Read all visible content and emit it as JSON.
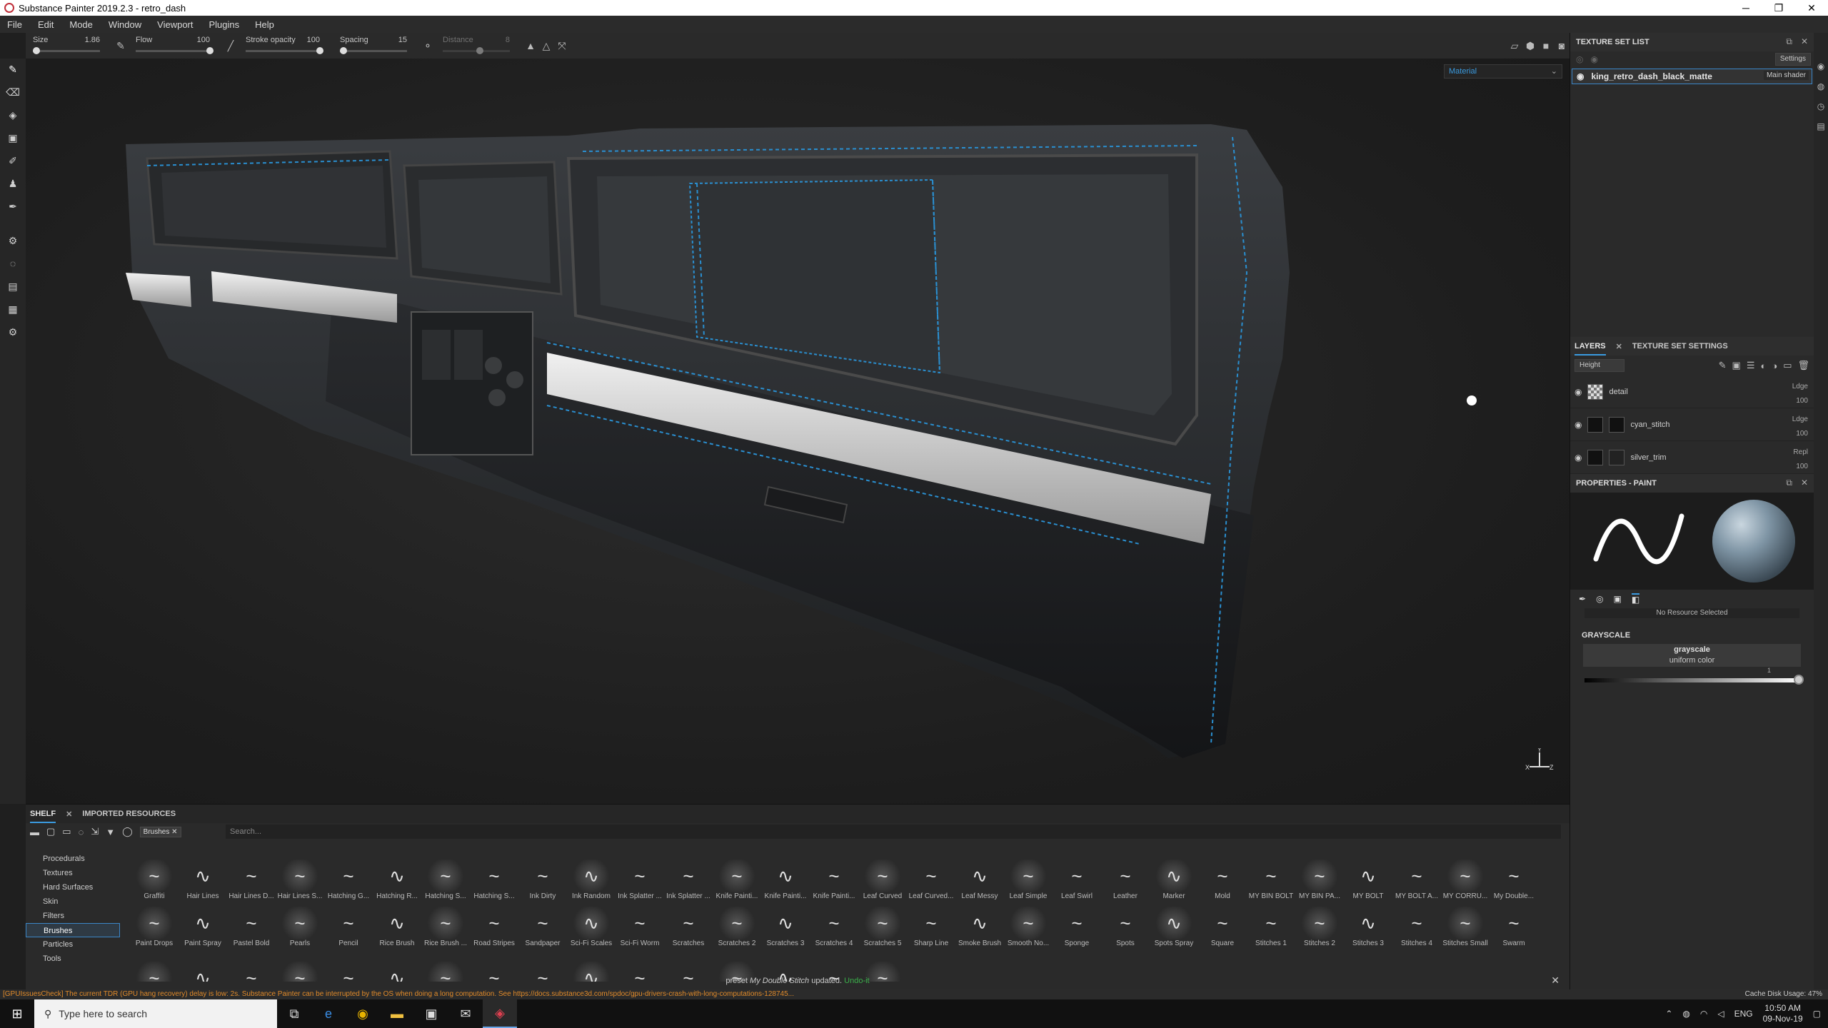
{
  "app": {
    "title": "Substance Painter 2019.2.3 - retro_dash"
  },
  "window_controls": {
    "minimize": "─",
    "maximize": "❐",
    "close": "✕"
  },
  "menu": [
    "File",
    "Edit",
    "Mode",
    "Window",
    "Viewport",
    "Plugins",
    "Help"
  ],
  "toolbar": {
    "size": {
      "label": "Size",
      "value": "1.86",
      "level": 0.05
    },
    "flow": {
      "label": "Flow",
      "value": "100",
      "level": 1.0
    },
    "stroke_opacity": {
      "label": "Stroke opacity",
      "value": "100",
      "level": 1.0
    },
    "spacing": {
      "label": "Spacing",
      "value": "15",
      "level": 0.05
    },
    "distance": {
      "label": "Distance",
      "value": "8"
    }
  },
  "viewport": {
    "material_mode": "Material",
    "axes": "Y\nX Z"
  },
  "texture_set_list": {
    "title": "TEXTURE SET LIST",
    "settings_label": "Settings",
    "item_name": "king_retro_dash_black_matte",
    "shader": "Main shader"
  },
  "layers_panel": {
    "tab_layers": "LAYERS",
    "tab_tss": "TEXTURE SET SETTINGS",
    "channel": "Height",
    "layers": [
      {
        "name": "detail",
        "blend": "Ldge",
        "opacity": "100"
      },
      {
        "name": "cyan_stitch",
        "blend": "Ldge",
        "opacity": "100"
      },
      {
        "name": "silver_trim",
        "blend": "Repl",
        "opacity": "100"
      }
    ]
  },
  "properties": {
    "title": "PROPERTIES - PAINT",
    "no_resource": "No Resource Selected",
    "section": "GRAYSCALE",
    "gray_name": "grayscale",
    "gray_sub": "uniform color",
    "gray_value": "1"
  },
  "shelf": {
    "tab_shelf": "SHELF",
    "tab_imported": "IMPORTED RESOURCES",
    "filter_chip": "Brushes",
    "search_placeholder": "Search...",
    "categories": [
      "Procedurals",
      "Textures",
      "Hard Surfaces",
      "Skin",
      "Filters",
      "Brushes",
      "Particles",
      "Tools"
    ],
    "active_category": "Brushes",
    "row1": [
      "Graffiti",
      "Hair Lines",
      "Hair Lines D...",
      "Hair Lines S...",
      "Hatching G...",
      "Hatching R...",
      "Hatching S...",
      "Hatching S...",
      "Ink Dirty",
      "Ink Random",
      "Ink Splatter ...",
      "Ink Splatter ...",
      "Knife Painti...",
      "Knife Painti...",
      "Knife Painti...",
      "Leaf Curved",
      "Leaf Curved...",
      "Leaf Messy",
      "Leaf Simple",
      "Leaf Swirl",
      "Leather",
      "Marker",
      "Mold",
      "MY BIN BOLT",
      "MY BIN PA...",
      "MY BOLT",
      "MY BOLT A...",
      "MY CORRU...",
      "My Double..."
    ],
    "row2": [
      "Paint Drops",
      "Paint Spray",
      "Pastel Bold",
      "Pearls",
      "Pencil",
      "Rice Brush",
      "Rice Brush ...",
      "Road Stripes",
      "Sandpaper",
      "Sci-Fi Scales",
      "Sci-Fi Worm",
      "Scratches",
      "Scratches 2",
      "Scratches 3",
      "Scratches 4",
      "Scratches 5",
      "Sharp Line",
      "Smoke Brush",
      "Smooth No...",
      "Sponge",
      "Spots",
      "Spots Spray",
      "Square",
      "Stitches 1",
      "Stitches 2",
      "Stitches 3",
      "Stitches 4",
      "Stitches Small",
      "Swarm"
    ],
    "status_prefix": "preset",
    "status_name": "My Double Stitch",
    "status_suffix": "updated.",
    "undo": "Undo-it"
  },
  "statusbar": {
    "message": "[GPUIssuesCheck] The current TDR (GPU hang recovery) delay is low: 2s. Substance Painter can be interrupted by the OS when doing a long computation. See https://docs.substance3d.com/spdoc/gpu-drivers-crash-with-long-computations-128745...",
    "cache": "Cache Disk Usage:   47%"
  },
  "taskbar": {
    "search_placeholder": "Type here to search",
    "lang": "ENG",
    "time": "10:50 AM",
    "date": "09-Nov-19"
  },
  "colors": {
    "accent": "#3a9be0",
    "stitch": "#2a8fd0",
    "warning": "#e08a2a"
  }
}
